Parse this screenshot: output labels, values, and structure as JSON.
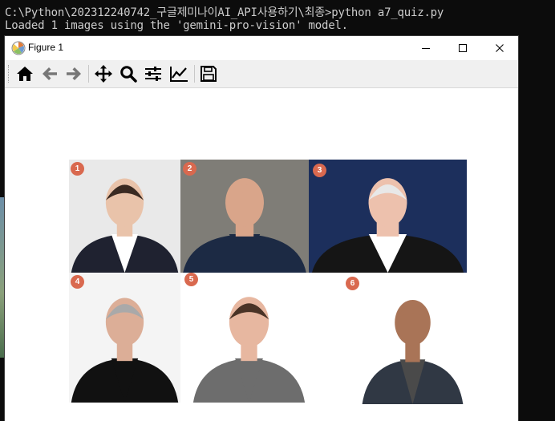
{
  "console": {
    "line1": "C:\\Python\\202312240742_구글제미나이AI_API사용하기\\최종>python a7_quiz.py",
    "line2": "Loaded 1 images using the 'gemini-pro-vision' model."
  },
  "window": {
    "title": "Figure 1",
    "controls": [
      "minimize",
      "maximize",
      "close"
    ]
  },
  "toolbar": {
    "tools": [
      {
        "name": "home",
        "icon": "home-icon"
      },
      {
        "name": "back",
        "icon": "arrow-left-icon"
      },
      {
        "name": "forward",
        "icon": "arrow-right-icon"
      },
      {
        "name": "pan",
        "icon": "move-icon"
      },
      {
        "name": "zoom",
        "icon": "zoom-icon"
      },
      {
        "name": "configure-subplots",
        "icon": "sliders-icon"
      },
      {
        "name": "edit-axis",
        "icon": "chart-line-icon"
      },
      {
        "name": "save",
        "icon": "floppy-icon"
      }
    ]
  },
  "figure": {
    "photos": [
      {
        "number": "1",
        "background": "#e9e9e9",
        "skin": "#e9c3aa",
        "hair": "#3a2a22",
        "clothing": "#1f2230",
        "shirt": "#ffffff"
      },
      {
        "number": "2",
        "background": "#7f7d77",
        "skin": "#d9a58a",
        "hair": "#d9a58a",
        "clothing": "#1c2a44",
        "shirt": "#1c2a44"
      },
      {
        "number": "3",
        "background": "#1c2f5c",
        "skin": "#edc1ad",
        "hair": "#e8e8e8",
        "clothing": "#151515",
        "shirt": "#ffffff"
      },
      {
        "number": "4",
        "background": "#f4f4f4",
        "skin": "#dcae97",
        "hair": "#a9a9a9",
        "clothing": "#111111",
        "shirt": "#111111"
      },
      {
        "number": "5",
        "background": "#ffffff",
        "skin": "#e7b7a0",
        "hair": "#4a3326",
        "clothing": "#6d6d6d",
        "shirt": "#6d6d6d"
      },
      {
        "number": "6",
        "background": "#ffffff",
        "skin": "#a97457",
        "hair": "#a97457",
        "clothing": "#303844",
        "shirt": "#4a4a4a"
      }
    ]
  }
}
